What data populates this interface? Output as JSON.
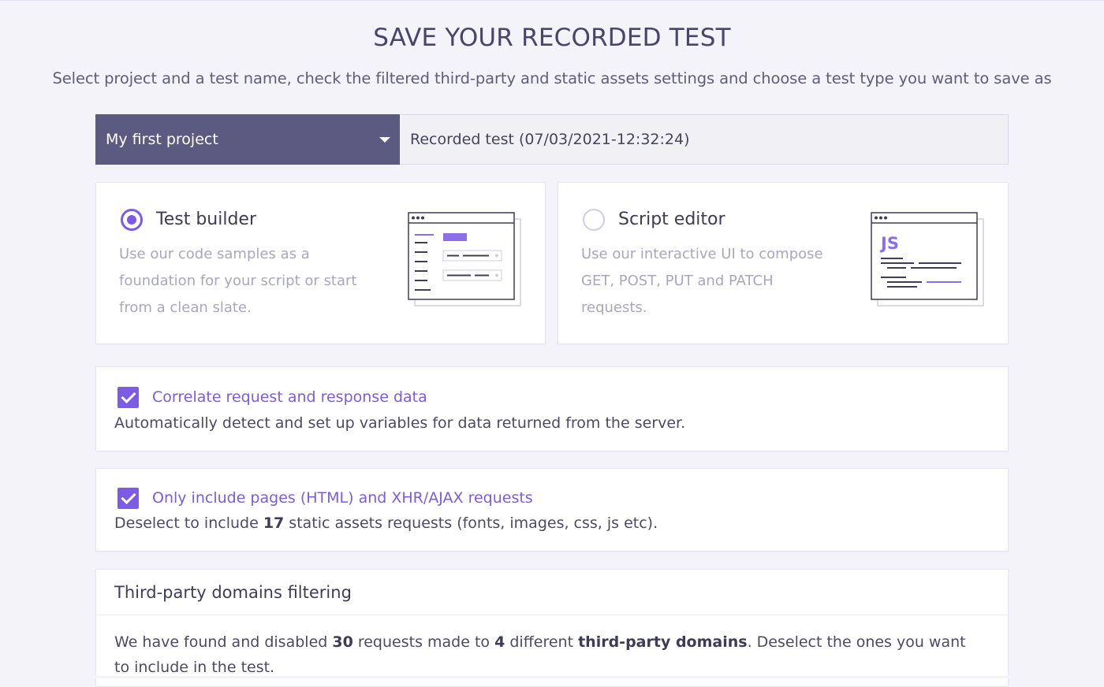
{
  "header": {
    "title": "SAVE YOUR RECORDED TEST",
    "subtitle": "Select project and a test name, check the filtered third-party and static assets settings and choose a test type you want to save as"
  },
  "project": {
    "selected": "My first project",
    "test_name": "Recorded test (07/03/2021-12:32:24)"
  },
  "test_types": {
    "builder": {
      "label": "Test builder",
      "description": "Use our code samples as a foundation for your script or start from a clean slate.",
      "selected": true
    },
    "script": {
      "label": "Script editor",
      "description": "Use our interactive UI to compose GET, POST, PUT and PATCH requests.",
      "selected": false,
      "illustration_text": "JS"
    }
  },
  "options": {
    "correlate": {
      "label": "Correlate request and response data",
      "description": "Automatically detect and set up variables for data returned from the server.",
      "checked": true
    },
    "pages_only": {
      "label": "Only include pages (HTML) and XHR/AJAX requests",
      "desc_prefix": "Deselect to include ",
      "desc_count": "17",
      "desc_suffix": " static assets requests (fonts, images, css, js etc).",
      "checked": true
    }
  },
  "third_party": {
    "title": "Third-party domains filtering",
    "text_1": "We have found and disabled ",
    "requests_count": "30",
    "text_2": " requests made to ",
    "domains_count": "4",
    "text_3": " different ",
    "domains_label": "third-party domains",
    "text_4": ". Deselect the ones you want to include in the test."
  },
  "colors": {
    "accent": "#7c5ce6",
    "select_bg": "#5c5a81",
    "page_bg": "#f4f3fa"
  }
}
